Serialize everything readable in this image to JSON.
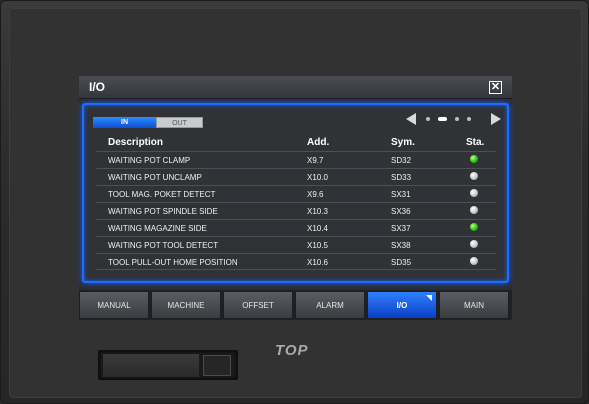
{
  "window": {
    "title": "I/O",
    "close_glyph": "✕"
  },
  "tabs": [
    {
      "label": "IN",
      "active": true
    },
    {
      "label": "OUT",
      "active": false
    }
  ],
  "pager": {
    "pages": 4,
    "current": 1
  },
  "table": {
    "headers": {
      "description": "Description",
      "address": "Add.",
      "symbol": "Sym.",
      "status": "Sta."
    },
    "rows": [
      {
        "description": "WAITING POT CLAMP",
        "address": "X9.7",
        "symbol": "SD32",
        "status": "on"
      },
      {
        "description": "WAITING POT UNCLAMP",
        "address": "X10.0",
        "symbol": "SD33",
        "status": "off"
      },
      {
        "description": "TOOL MAG. POKET DETECT",
        "address": "X9.6",
        "symbol": "SX31",
        "status": "off"
      },
      {
        "description": "WAITING POT SPINDLE SIDE",
        "address": "X10.3",
        "symbol": "SX36",
        "status": "off"
      },
      {
        "description": "WAITING MAGAZINE SIDE",
        "address": "X10.4",
        "symbol": "SX37",
        "status": "on"
      },
      {
        "description": "WAITING POT TOOL DETECT",
        "address": "X10.5",
        "symbol": "SX38",
        "status": "off"
      },
      {
        "description": "TOOL PULL-OUT HOME POSITION",
        "address": "X10.6",
        "symbol": "SD35",
        "status": "off"
      }
    ]
  },
  "nav": [
    {
      "label": "MANUAL",
      "active": false
    },
    {
      "label": "MACHINE",
      "active": false
    },
    {
      "label": "OFFSET",
      "active": false
    },
    {
      "label": "ALARM",
      "active": false
    },
    {
      "label": "I/O",
      "active": true
    },
    {
      "label": "MAIN",
      "active": false
    }
  ],
  "brand": "TOP",
  "colors": {
    "accent": "#1e6bff",
    "led_on": "#2fbf1a",
    "led_off": "#c8c8c8"
  }
}
